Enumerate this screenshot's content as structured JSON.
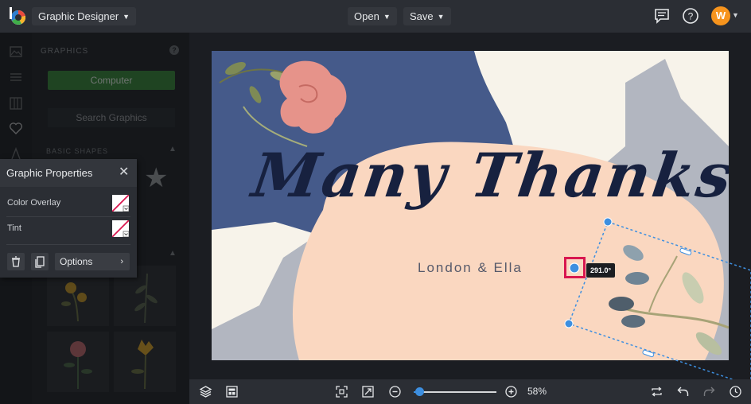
{
  "app": {
    "name": "Graphic Designer",
    "menus": [
      {
        "label": "Open"
      },
      {
        "label": "Save"
      }
    ],
    "user_initial": "W",
    "accent_color": "#f7941d"
  },
  "graphics_panel": {
    "title": "GRAPHICS",
    "help": "?",
    "computer_button": "Computer",
    "search_button": "Search Graphics",
    "basic_shapes_label": "BASIC SHAPES",
    "computer_button_color": "#3a8a3d"
  },
  "graphic_properties": {
    "title": "Graphic Properties",
    "rows": [
      {
        "label": "Color Overlay"
      },
      {
        "label": "Tint"
      }
    ],
    "options_label": "Options"
  },
  "canvas": {
    "headline": "Many Thanks",
    "names": "London & Ella",
    "rotation_angle": "291.0°",
    "colors": {
      "navy": "#455a8a",
      "peach": "#fad7c0",
      "gray": "#b2b6c0",
      "cream": "#f7f3ea",
      "text": "#17213f"
    }
  },
  "bottom_bar": {
    "zoom_value": "58",
    "zoom_unit": "%",
    "zoom_fraction": 0.07
  },
  "icons": [
    "logo-icon",
    "chat-icon",
    "help-icon",
    "layers-icon",
    "template-icon",
    "fit-screen-icon",
    "expand-icon",
    "zoom-out-icon",
    "zoom-in-icon",
    "replace-icon",
    "undo-icon",
    "redo-icon",
    "history-icon",
    "trash-icon",
    "copy-icon",
    "star-icon"
  ]
}
